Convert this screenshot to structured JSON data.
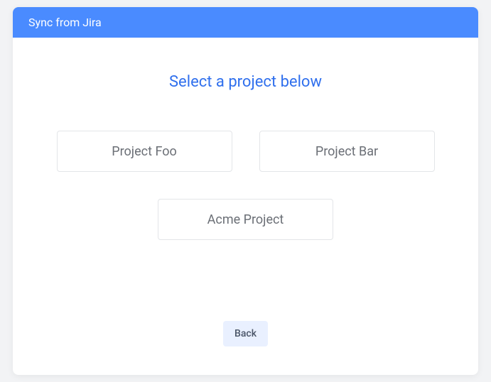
{
  "header": {
    "title": "Sync from Jira"
  },
  "body": {
    "prompt": "Select a project below",
    "projects": [
      {
        "label": "Project Foo"
      },
      {
        "label": "Project Bar"
      },
      {
        "label": "Acme Project"
      }
    ]
  },
  "footer": {
    "back_label": "Back"
  }
}
